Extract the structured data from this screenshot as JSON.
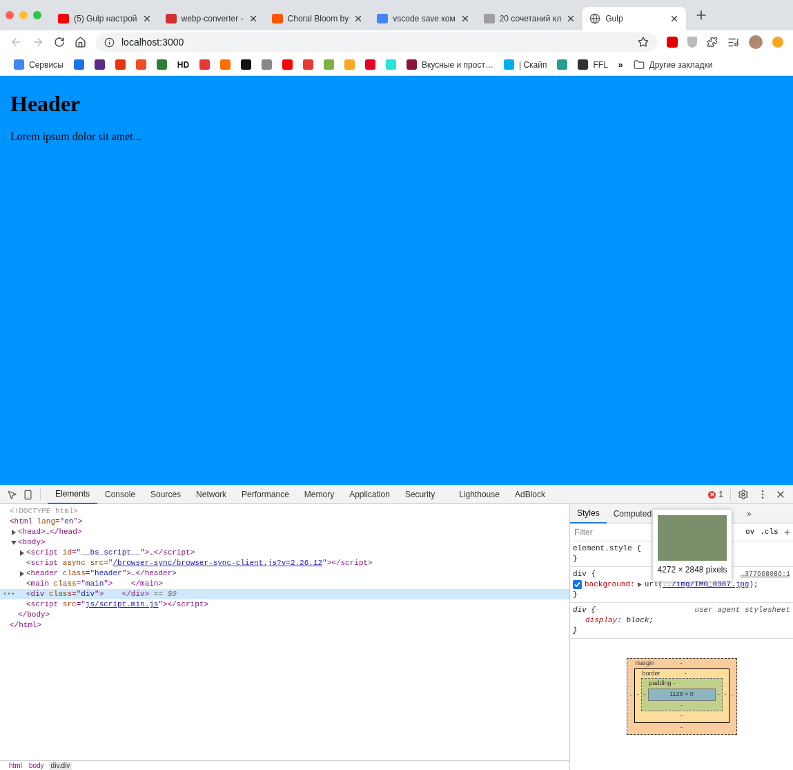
{
  "browser_tabs": [
    {
      "title": "(5) Gulp настрой",
      "color": "#ff0000",
      "selected": false
    },
    {
      "title": "webp-converter -",
      "color": "#d32f2f",
      "selected": false
    },
    {
      "title": "Choral Bloom by",
      "color": "#ff5500",
      "selected": false
    },
    {
      "title": "vscode save ком",
      "color": "#4285f4",
      "selected": false
    },
    {
      "title": "20 сочетаний кл",
      "color": "#9e9e9e",
      "selected": false
    },
    {
      "title": "Gulp",
      "color": "#5f6368",
      "selected": true
    }
  ],
  "address": {
    "url": "localhost:3000"
  },
  "bookmarks": [
    {
      "label": "Сервисы",
      "color": "#4285f4"
    },
    {
      "color": "#1a73e8"
    },
    {
      "color": "#5b2a86"
    },
    {
      "color": "#e8340c"
    },
    {
      "color": "#f04e23"
    },
    {
      "color": "#2e7d32"
    },
    {
      "label": "HD"
    },
    {
      "color": "#e53935"
    },
    {
      "color": "#ff6f00"
    },
    {
      "color": "#111111"
    },
    {
      "color": "#888888"
    },
    {
      "color": "#ff0000"
    },
    {
      "color": "#e53935"
    },
    {
      "color": "#7cb342"
    },
    {
      "color": "#f9a825"
    },
    {
      "color": "#e60023"
    },
    {
      "color": "#23e5db"
    },
    {
      "label": "Вкусные и прост…",
      "color": "#8b1538"
    },
    {
      "label": "| Скайп",
      "color": "#00aff0"
    },
    {
      "color": "#2a9d8f"
    },
    {
      "label": "FFL",
      "color": "#333333"
    },
    {
      "label": "»"
    },
    {
      "label": "Другие закладки",
      "color": "#5f6368"
    }
  ],
  "page": {
    "heading": "Header",
    "paragraph": "Lorem ipsum dolor sit amet..."
  },
  "devtools": {
    "tabs": [
      {
        "label": "Elements",
        "selected": true
      },
      {
        "label": "Console",
        "selected": false
      },
      {
        "label": "Sources",
        "selected": false
      },
      {
        "label": "Network",
        "selected": false
      },
      {
        "label": "Performance",
        "selected": false
      },
      {
        "label": "Memory",
        "selected": false
      },
      {
        "label": "Application",
        "selected": false
      },
      {
        "label": "Security",
        "selected": false
      },
      {
        "label": "Lighthouse",
        "selected": false
      },
      {
        "label": "AdBlock",
        "selected": false
      }
    ],
    "error_count": "1",
    "tree": [
      {
        "segments": [
          {
            "kind": "doctype",
            "text": "<!DOCTYPE html>"
          }
        ]
      },
      {
        "segments": [
          {
            "kind": "tag",
            "text": "<html "
          },
          {
            "kind": "attr",
            "text": "lang"
          },
          {
            "kind": "tag",
            "text": "=\""
          },
          {
            "kind": "val",
            "text": "en"
          },
          {
            "kind": "tag",
            "text": "\">"
          }
        ],
        "closing": [
          {
            "kind": "tag",
            "text": "</html>"
          }
        ],
        "children": [
          {
            "segments": [
              {
                "kind": "tag",
                "text": "<head>"
              },
              {
                "kind": "plain",
                "text": "…"
              },
              {
                "kind": "tag",
                "text": "</head>"
              }
            ],
            "expanded": false
          },
          {
            "segments": [
              {
                "kind": "tag",
                "text": "<body>"
              }
            ],
            "expanded": true,
            "closing": [
              {
                "kind": "tag",
                "text": "</body>"
              }
            ],
            "children": [
              {
                "segments": [
                  {
                    "kind": "tag",
                    "text": "<script "
                  },
                  {
                    "kind": "attr",
                    "text": "id"
                  },
                  {
                    "kind": "tag",
                    "text": "=\""
                  },
                  {
                    "kind": "val",
                    "text": "__bs_script__"
                  },
                  {
                    "kind": "tag",
                    "text": "\">"
                  },
                  {
                    "kind": "plain",
                    "text": "…"
                  },
                  {
                    "kind": "tag",
                    "text": "</script>"
                  }
                ],
                "expanded": false
              },
              {
                "segments": [
                  {
                    "kind": "tag",
                    "text": "<script "
                  },
                  {
                    "kind": "attr",
                    "text": "async src"
                  },
                  {
                    "kind": "tag",
                    "text": "=\""
                  },
                  {
                    "kind": "link",
                    "text": "/browser-sync/browser-sync-client.js?v=2.26.12"
                  },
                  {
                    "kind": "tag",
                    "text": "\"></script>"
                  }
                ]
              },
              {
                "segments": [
                  {
                    "kind": "tag",
                    "text": "<header "
                  },
                  {
                    "kind": "attr",
                    "text": "class"
                  },
                  {
                    "kind": "tag",
                    "text": "=\""
                  },
                  {
                    "kind": "val",
                    "text": "header"
                  },
                  {
                    "kind": "tag",
                    "text": "\">"
                  },
                  {
                    "kind": "plain",
                    "text": "…"
                  },
                  {
                    "kind": "tag",
                    "text": "</header>"
                  }
                ],
                "expanded": false
              },
              {
                "segments": [
                  {
                    "kind": "tag",
                    "text": "<main "
                  },
                  {
                    "kind": "attr",
                    "text": "class"
                  },
                  {
                    "kind": "tag",
                    "text": "=\""
                  },
                  {
                    "kind": "val",
                    "text": "main"
                  },
                  {
                    "kind": "tag",
                    "text": "\">    </main>"
                  }
                ]
              },
              {
                "segments": [
                  {
                    "kind": "tag",
                    "text": "<div "
                  },
                  {
                    "kind": "attr",
                    "text": "class"
                  },
                  {
                    "kind": "tag",
                    "text": "=\""
                  },
                  {
                    "kind": "val",
                    "text": "div"
                  },
                  {
                    "kind": "tag",
                    "text": "\">    </div>"
                  },
                  {
                    "kind": "dim",
                    "text": " == $0"
                  }
                ],
                "selected": true,
                "marker": "•••"
              },
              {
                "segments": [
                  {
                    "kind": "tag",
                    "text": "<script "
                  },
                  {
                    "kind": "attr",
                    "text": "src"
                  },
                  {
                    "kind": "tag",
                    "text": "=\""
                  },
                  {
                    "kind": "link",
                    "text": "js/script.min.js"
                  },
                  {
                    "kind": "tag",
                    "text": "\"></script>"
                  }
                ]
              }
            ]
          }
        ]
      }
    ],
    "breadcrumbs": [
      {
        "label": "html",
        "selected": false
      },
      {
        "label": "body",
        "selected": false
      },
      {
        "label": "div.div",
        "selected": true
      }
    ],
    "styles": {
      "tabs": [
        {
          "label": "Styles",
          "selected": true
        },
        {
          "label": "Computed",
          "selected": false
        }
      ],
      "more": "»",
      "filter": {
        "placeholder": "Filter"
      },
      "hov": "ov",
      "cls": ".cls",
      "add": "+",
      "element_style": {
        "selector": "element.style {",
        "close": "}"
      },
      "rule": {
        "selector": "div {",
        "source": "…377668086:1",
        "property": "background:",
        "value_prefix": "url(",
        "link": "../img/IMG_0367.jpg",
        "value_suffix": ");",
        "checked": true,
        "close": "}"
      },
      "ua_rule": {
        "selector": "div {",
        "source": "user agent stylesheet",
        "property": "display",
        "value": ": block;",
        "close": "}"
      },
      "tooltip": {
        "caption": "4272 × 2848 pixels"
      }
    },
    "box_model": {
      "margin": "margin",
      "border": "border",
      "padding": "padding -",
      "content": "1128 × 0",
      "dash": "-"
    }
  }
}
